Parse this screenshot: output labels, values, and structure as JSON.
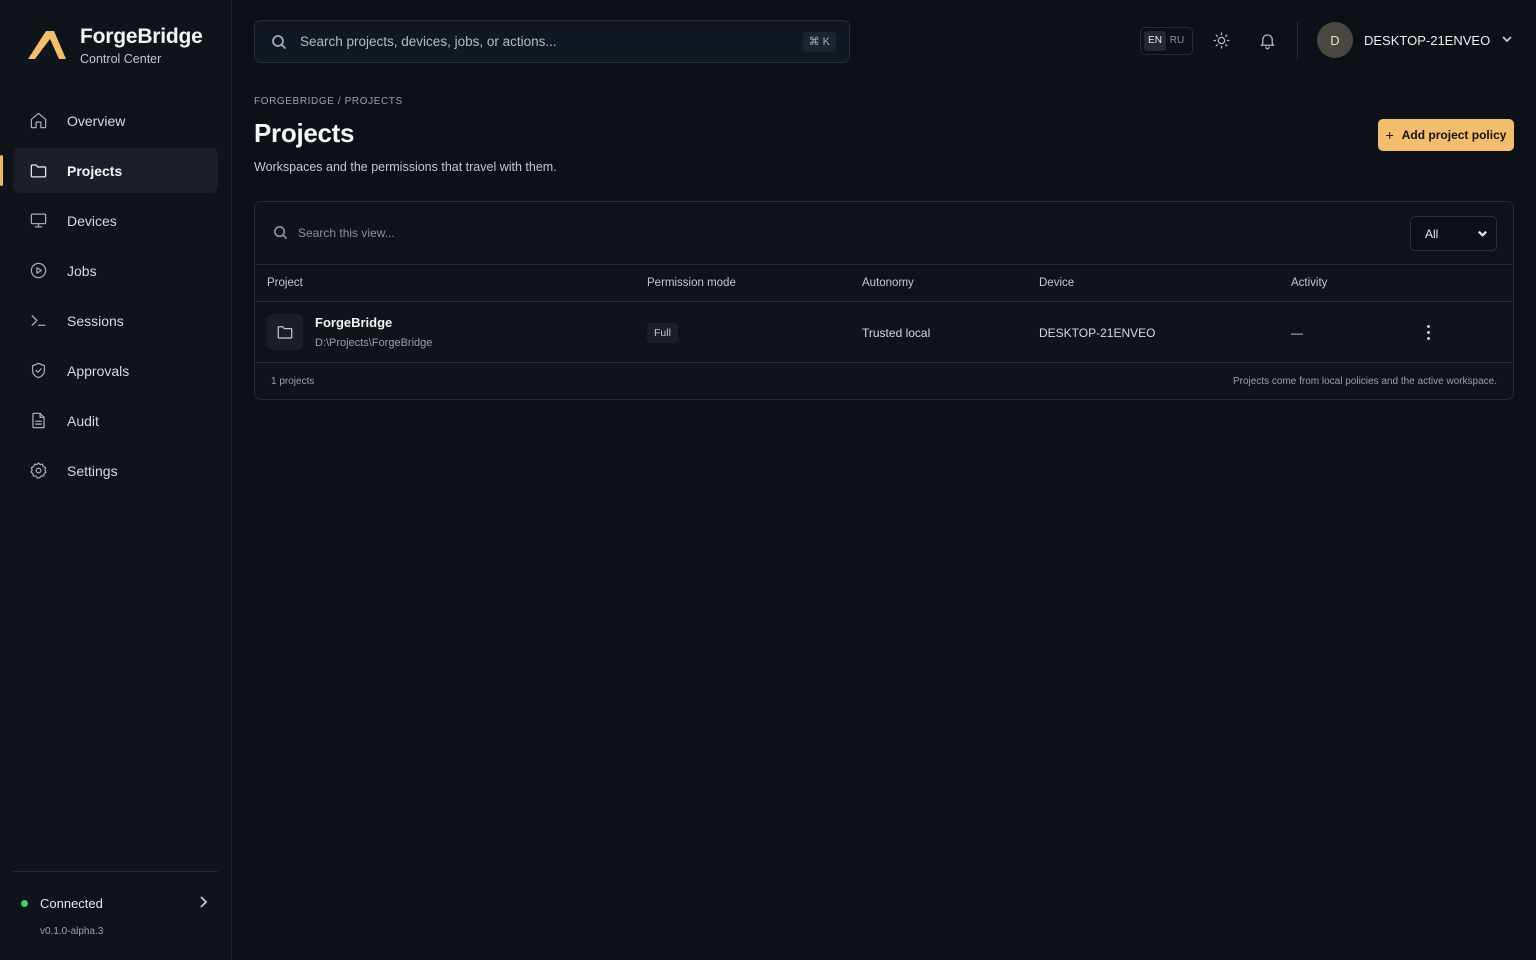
{
  "brand": {
    "name": "ForgeBridge",
    "subtitle": "Control Center"
  },
  "nav": [
    {
      "label": "Overview",
      "icon": "home-icon",
      "active": false
    },
    {
      "label": "Projects",
      "icon": "folder-icon",
      "active": true
    },
    {
      "label": "Devices",
      "icon": "monitor-icon",
      "active": false
    },
    {
      "label": "Jobs",
      "icon": "play-circle-icon",
      "active": false
    },
    {
      "label": "Sessions",
      "icon": "terminal-icon",
      "active": false
    },
    {
      "label": "Approvals",
      "icon": "shield-check-icon",
      "active": false
    },
    {
      "label": "Audit",
      "icon": "document-icon",
      "active": false
    },
    {
      "label": "Settings",
      "icon": "gear-icon",
      "active": false
    }
  ],
  "status": {
    "label": "Connected",
    "version": "v0.1.0-alpha.3",
    "color": "#3fcf6b"
  },
  "topbar": {
    "search_placeholder": "Search projects, devices, jobs, or actions...",
    "shortcut": "⌘ K",
    "lang_active": "EN",
    "lang_other": "RU",
    "avatar_initial": "D",
    "user_name": "DESKTOP-21ENVEO"
  },
  "page": {
    "breadcrumb": "FORGEBRIDGE / PROJECTS",
    "title": "Projects",
    "description": "Workspaces and the permissions that travel with them.",
    "add_button": "Add project policy",
    "accent": "#f2bd6e"
  },
  "table": {
    "search_placeholder": "Search this view...",
    "filter_value": "All",
    "columns": [
      "Project",
      "Permission mode",
      "Autonomy",
      "Device",
      "Activity"
    ],
    "rows": [
      {
        "name": "ForgeBridge",
        "path": "D:\\Projects\\ForgeBridge",
        "permission": "Full",
        "autonomy": "Trusted local",
        "device": "DESKTOP-21ENVEO",
        "activity": "—"
      }
    ],
    "count": "1 projects",
    "footnote": "Projects come from local policies and the active workspace."
  }
}
